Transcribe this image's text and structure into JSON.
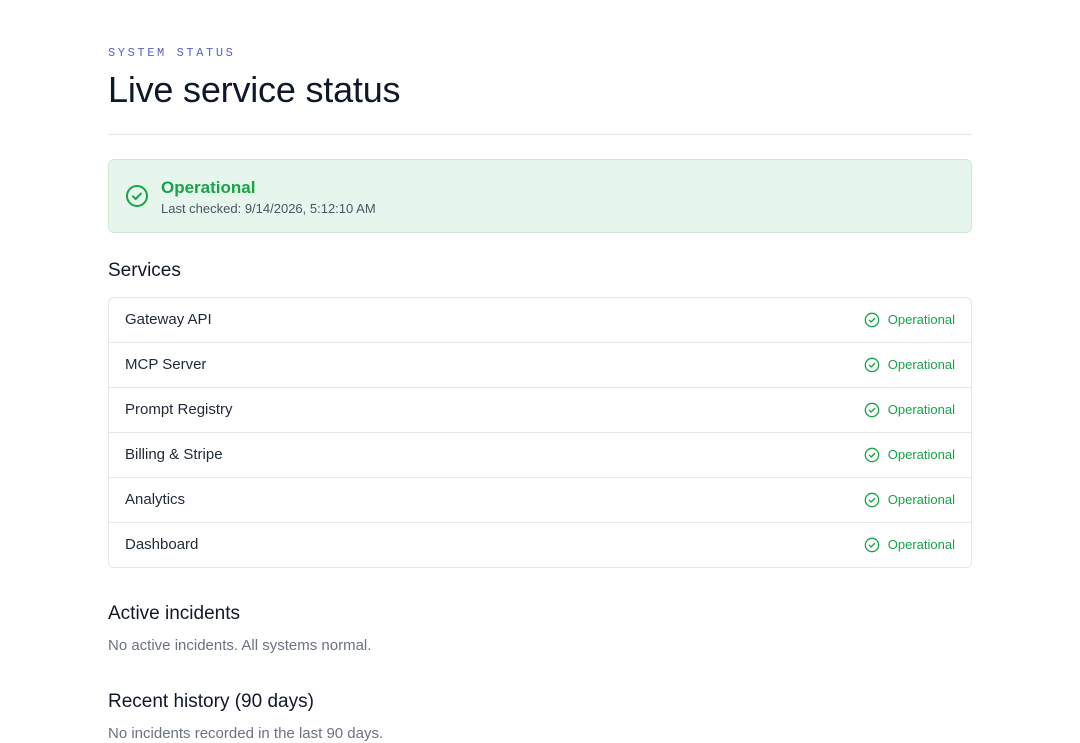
{
  "header": {
    "eyebrow": "SYSTEM STATUS",
    "title": "Live service status"
  },
  "banner": {
    "status": "Operational",
    "last_checked": "Last checked: 9/14/2026, 5:12:10 AM",
    "icon": "check-circle-icon"
  },
  "services": {
    "heading": "Services",
    "items": [
      {
        "name": "Gateway API",
        "status": "Operational",
        "icon": "check-circle-icon"
      },
      {
        "name": "MCP Server",
        "status": "Operational",
        "icon": "check-circle-icon"
      },
      {
        "name": "Prompt Registry",
        "status": "Operational",
        "icon": "check-circle-icon"
      },
      {
        "name": "Billing & Stripe",
        "status": "Operational",
        "icon": "check-circle-icon"
      },
      {
        "name": "Analytics",
        "status": "Operational",
        "icon": "check-circle-icon"
      },
      {
        "name": "Dashboard",
        "status": "Operational",
        "icon": "check-circle-icon"
      }
    ]
  },
  "incidents": {
    "heading": "Active incidents",
    "message": "No active incidents. All systems normal."
  },
  "history": {
    "heading": "Recent history (90 days)",
    "message": "No incidents recorded in the last 90 days."
  },
  "colors": {
    "accent": "#5b5fc7",
    "operational": "#16a34a",
    "banner_background": "#e7f6ec"
  }
}
